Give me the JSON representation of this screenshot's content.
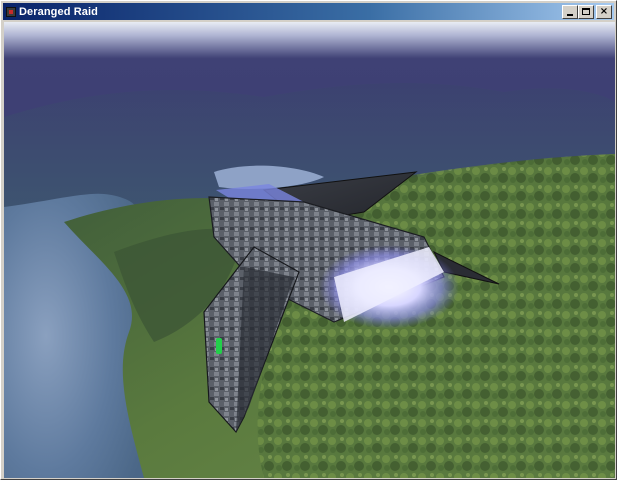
{
  "window": {
    "title": "Deranged Raid",
    "controls": {
      "minimize": "minimize",
      "maximize": "maximize",
      "close": "×"
    }
  },
  "scene": {
    "sky_color": "#3b3c6e",
    "haze_color": "#e8ecf4",
    "water_color": "#6f86a8",
    "land_color": "#4f6b3a",
    "ship_hull_color": "#4a4f58",
    "engine_glow_color": "#c9c8ff",
    "cockpit_light_color": "#22d04a"
  }
}
